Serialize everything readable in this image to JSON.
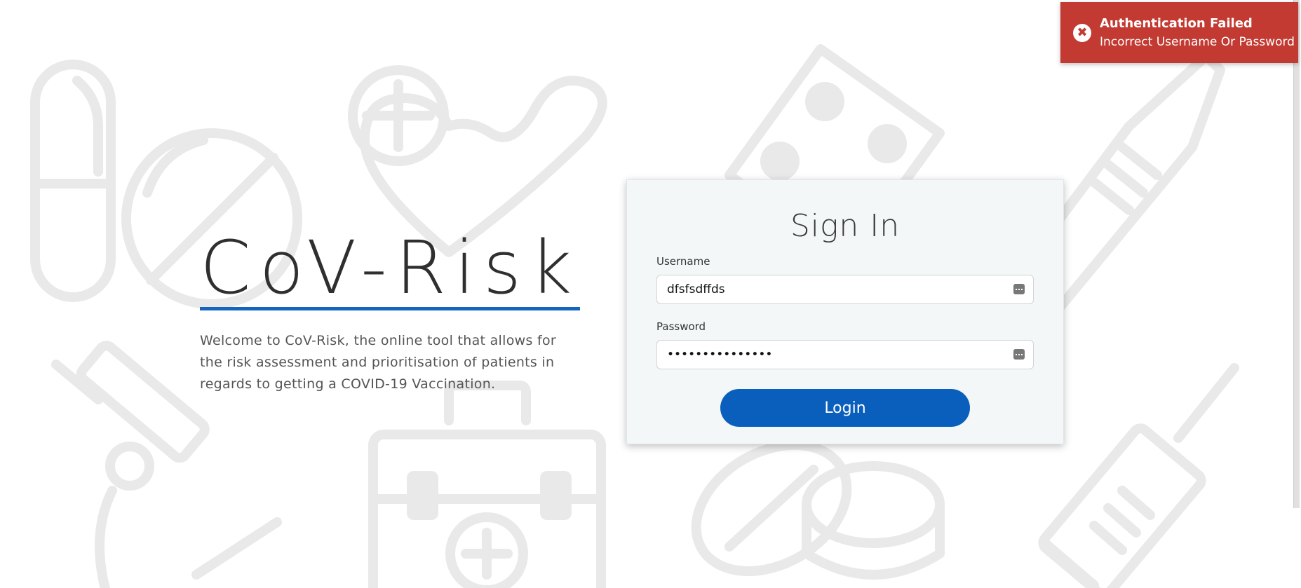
{
  "brand": {
    "title": "CoV-Risk",
    "description": "Welcome to CoV-Risk, the online tool that allows for the risk assessment and prioritisation of patients in regards to getting a COVID-19 Vaccination."
  },
  "login_form": {
    "title": "Sign In",
    "username_label": "Username",
    "username_value": "dfsfsdffds",
    "password_label": "Password",
    "password_value": "•••••••••••••••",
    "login_button": "Login"
  },
  "toast": {
    "title": "Authentication Failed",
    "message": "Incorrect Username Or Password",
    "icon": "error-x-icon"
  },
  "colors": {
    "accent": "#0a5fbd",
    "error": "#c23a32",
    "background_icons": "#e9e9e9",
    "card_background": "#f3f7f7"
  }
}
